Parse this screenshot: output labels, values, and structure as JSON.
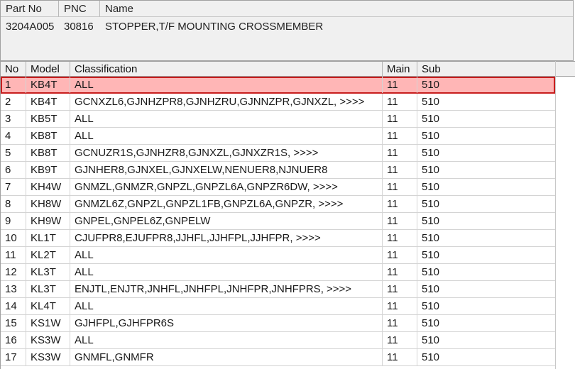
{
  "part_panel": {
    "headers": {
      "part_no": "Part No",
      "pnc": "PNC",
      "name": "Name"
    },
    "values": {
      "part_no": "3204A005",
      "pnc": "30816",
      "name": "STOPPER,T/F MOUNTING CROSSMEMBER"
    }
  },
  "grid": {
    "columns": {
      "no": "No",
      "model": "Model",
      "classification": "Classification",
      "main": "Main",
      "sub": "Sub"
    },
    "selected_row": 1,
    "rows": [
      {
        "no": "1",
        "model": "KB4T",
        "classification": "ALL",
        "main": "11",
        "sub": "510"
      },
      {
        "no": "2",
        "model": "KB4T",
        "classification": "GCNXZL6,GJNHZPR8,GJNHZRU,GJNNZPR,GJNXZL,  >>>>",
        "main": "11",
        "sub": "510"
      },
      {
        "no": "3",
        "model": "KB5T",
        "classification": "ALL",
        "main": "11",
        "sub": "510"
      },
      {
        "no": "4",
        "model": "KB8T",
        "classification": "ALL",
        "main": "11",
        "sub": "510"
      },
      {
        "no": "5",
        "model": "KB8T",
        "classification": "GCNUZR1S,GJNHZR8,GJNXZL,GJNXZR1S,  >>>>",
        "main": "11",
        "sub": "510"
      },
      {
        "no": "6",
        "model": "KB9T",
        "classification": "GJNHER8,GJNXEL,GJNXELW,NENUER8,NJNUER8",
        "main": "11",
        "sub": "510"
      },
      {
        "no": "7",
        "model": "KH4W",
        "classification": "GNMZL,GNMZR,GNPZL,GNPZL6A,GNPZR6DW,  >>>>",
        "main": "11",
        "sub": "510"
      },
      {
        "no": "8",
        "model": "KH8W",
        "classification": "GNMZL6Z,GNPZL,GNPZL1FB,GNPZL6A,GNPZR,  >>>>",
        "main": "11",
        "sub": "510"
      },
      {
        "no": "9",
        "model": "KH9W",
        "classification": "GNPEL,GNPEL6Z,GNPELW",
        "main": "11",
        "sub": "510"
      },
      {
        "no": "10",
        "model": "KL1T",
        "classification": "CJUFPR8,EJUFPR8,JJHFL,JJHFPL,JJHFPR,  >>>>",
        "main": "11",
        "sub": "510"
      },
      {
        "no": "11",
        "model": "KL2T",
        "classification": "ALL",
        "main": "11",
        "sub": "510"
      },
      {
        "no": "12",
        "model": "KL3T",
        "classification": "ALL",
        "main": "11",
        "sub": "510"
      },
      {
        "no": "13",
        "model": "KL3T",
        "classification": "ENJTL,ENJTR,JNHFL,JNHFPL,JNHFPR,JNHFPRS,  >>>>",
        "main": "11",
        "sub": "510"
      },
      {
        "no": "14",
        "model": "KL4T",
        "classification": "ALL",
        "main": "11",
        "sub": "510"
      },
      {
        "no": "15",
        "model": "KS1W",
        "classification": "GJHFPL,GJHFPR6S",
        "main": "11",
        "sub": "510"
      },
      {
        "no": "16",
        "model": "KS3W",
        "classification": "ALL",
        "main": "11",
        "sub": "510"
      },
      {
        "no": "17",
        "model": "KS3W",
        "classification": "GNMFL,GNMFR",
        "main": "11",
        "sub": "510"
      }
    ]
  },
  "colors": {
    "selected_fill": "#ffb6b6",
    "selected_border": "#c81e1e"
  }
}
